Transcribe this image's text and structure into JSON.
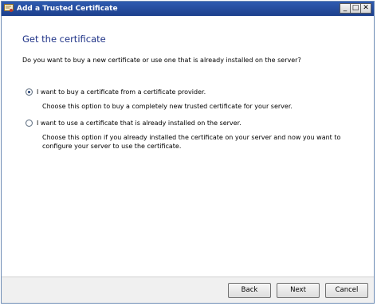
{
  "window": {
    "title": "Add a Trusted Certificate",
    "controls": {
      "minimize": "_",
      "maximize": "□",
      "close": "✕"
    }
  },
  "page": {
    "heading": "Get the certificate",
    "question": "Do you want to buy a new certificate or use one that is already installed on the server?"
  },
  "options": [
    {
      "label": "I want to buy a certificate from a certificate provider.",
      "description": [
        "Choose this option to buy a completely new trusted certificate for your server."
      ],
      "selected": true
    },
    {
      "label": "I want to use a certificate that is already installed on the server.",
      "description": [
        "Choose this option if you already installed the certificate on your server and now you want to",
        "configure your server to use the certificate."
      ],
      "selected": false
    }
  ],
  "buttons": {
    "back": "Back",
    "next": "Next",
    "cancel": "Cancel"
  },
  "colors": {
    "title_bar": "#1c3f8c",
    "heading": "#1e3287",
    "footer": "#f0f0f0"
  }
}
